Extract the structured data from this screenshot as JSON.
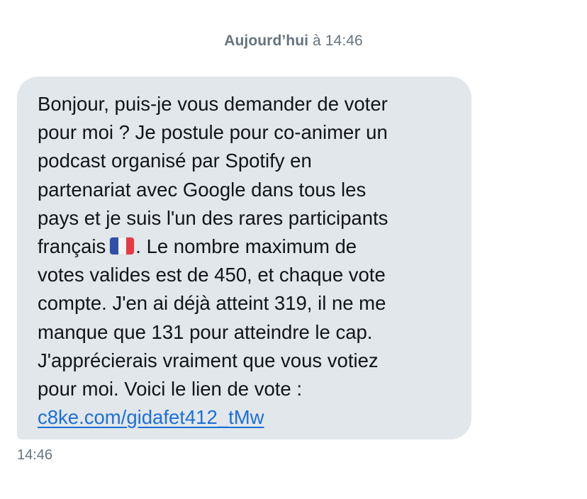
{
  "header": {
    "day": "Aujourd’hui",
    "time": "à 14:46"
  },
  "message": {
    "lines": [
      "Bonjour, puis-je vous demander de voter",
      "pour moi ? Je postule pour co-animer un",
      "podcast organisé par Spotify en",
      "partenariat avec Google dans tous les",
      "pays et je suis l'un des rares participants",
      "français",
      ". Le nombre maximum de",
      "votes valides est de 450, et chaque vote",
      "compte. J'en ai déjà atteint 319, il ne me",
      "manque que 131 pour atteindre le cap.",
      "J'apprécierais vraiment que vous votiez",
      "pour moi. Voici le lien de vote :"
    ],
    "flag_icon": "france-flag-icon",
    "link": "c8ke.com/gidafet412_tMw",
    "timestamp": "14:46"
  },
  "colors": {
    "bubble": "#e2e7eb",
    "link": "#1d6fd8",
    "meta_text": "#66737f",
    "flag_blue": "#2f4fa8",
    "flag_white": "#f4f4f4",
    "flag_red": "#e53a44"
  }
}
